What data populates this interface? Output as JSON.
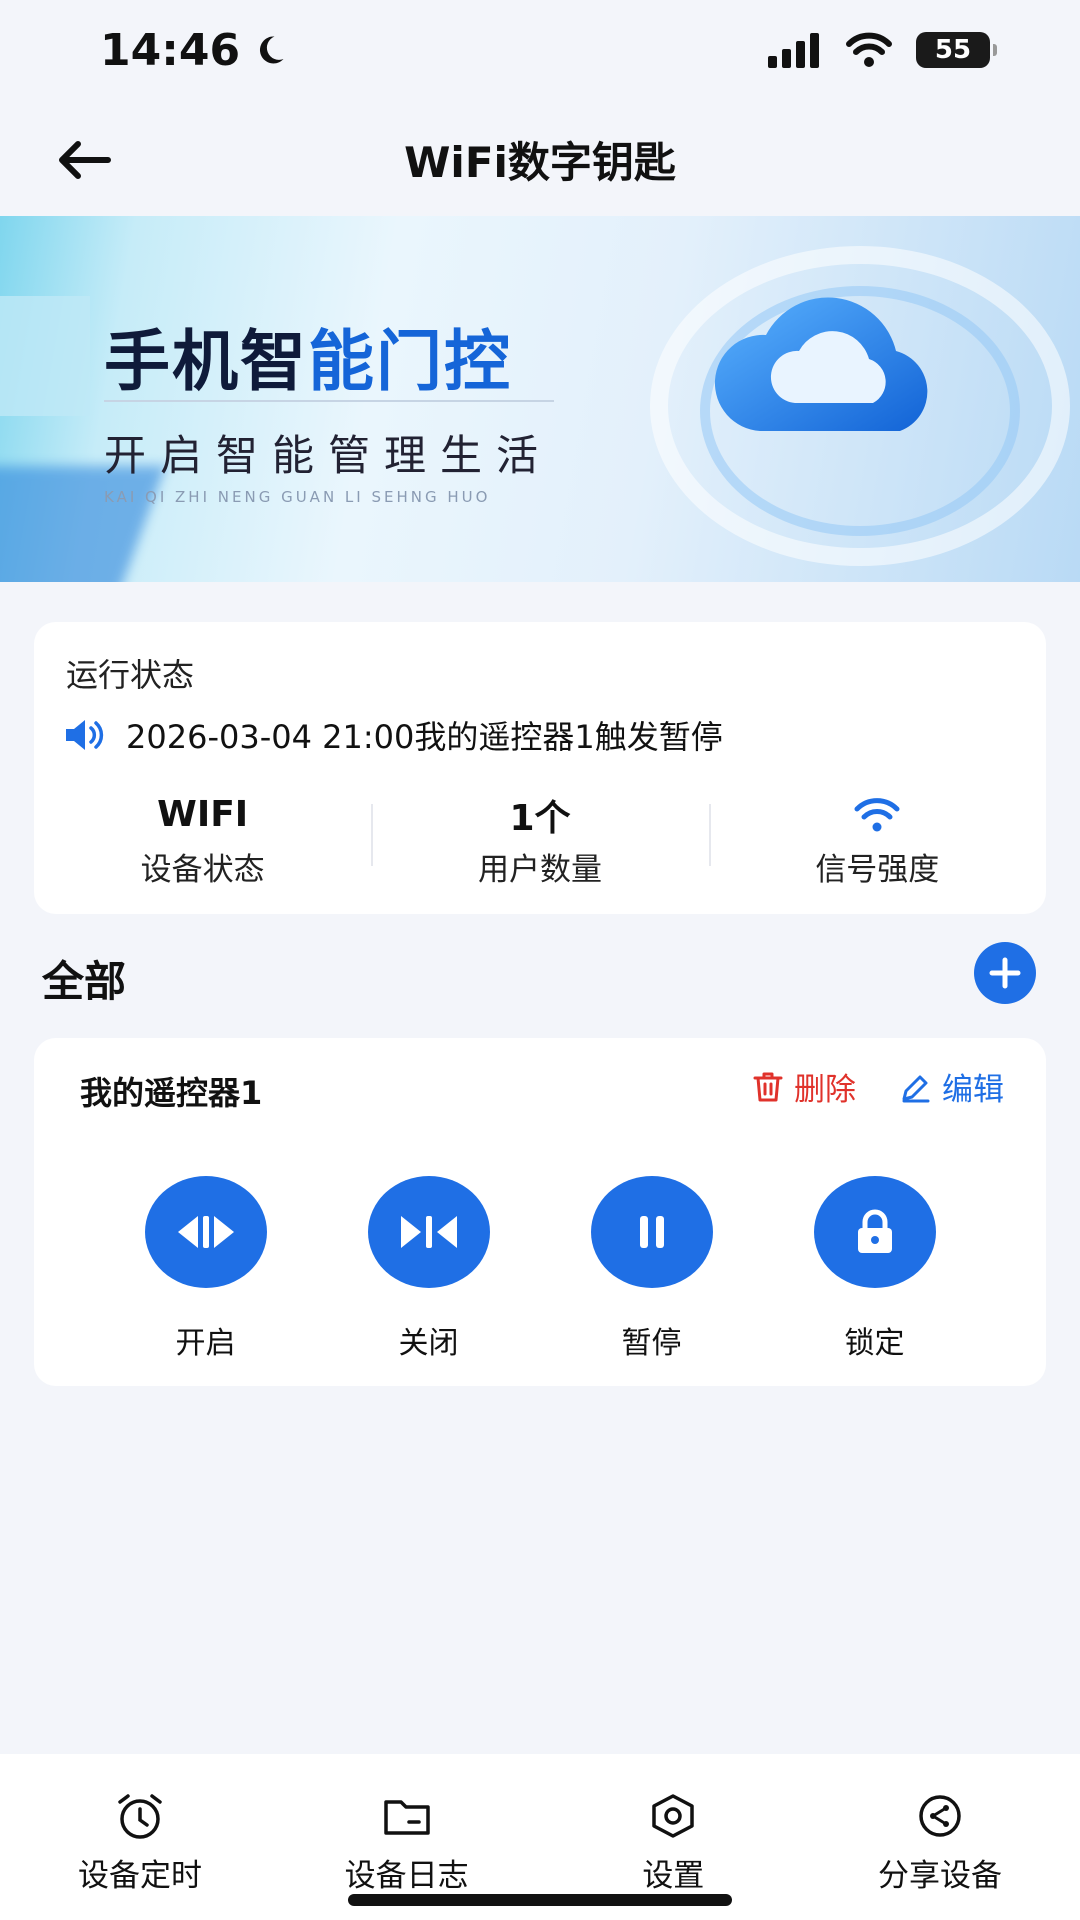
{
  "status_bar": {
    "time": "14:46",
    "battery": "55"
  },
  "header": {
    "title": "WiFi数字钥匙"
  },
  "banner": {
    "title_part1": "手机智",
    "title_part2": "能门控",
    "subtitle": "开启智能管理生活",
    "pinyin": "KAI QI ZHI NENG GUAN LI SEHNG HUO"
  },
  "status_card": {
    "label": "运行状态",
    "notice": "2026-03-04 21:00我的遥控器1触发暂停",
    "stats": [
      {
        "value": "WIFI",
        "label": "设备状态"
      },
      {
        "value": "1个",
        "label": "用户数量"
      },
      {
        "value": "",
        "label": "信号强度"
      }
    ]
  },
  "section": {
    "title": "全部"
  },
  "device": {
    "name": "我的遥控器1",
    "delete_label": "删除",
    "edit_label": "编辑",
    "controls": [
      {
        "label": "开启",
        "icon": "open-icon"
      },
      {
        "label": "关闭",
        "icon": "close-doors-icon"
      },
      {
        "label": "暂停",
        "icon": "pause-icon"
      },
      {
        "label": "锁定",
        "icon": "lock-icon"
      }
    ]
  },
  "bottom_nav": {
    "items": [
      {
        "label": "设备定时",
        "icon": "alarm-clock-icon"
      },
      {
        "label": "设备日志",
        "icon": "folder-icon"
      },
      {
        "label": "设置",
        "icon": "hexagon-settings-icon"
      },
      {
        "label": "分享设备",
        "icon": "share-icon"
      }
    ]
  },
  "colors": {
    "accent": "#1f6fe5",
    "danger": "#e0322b",
    "background": "#f3f5fa"
  }
}
